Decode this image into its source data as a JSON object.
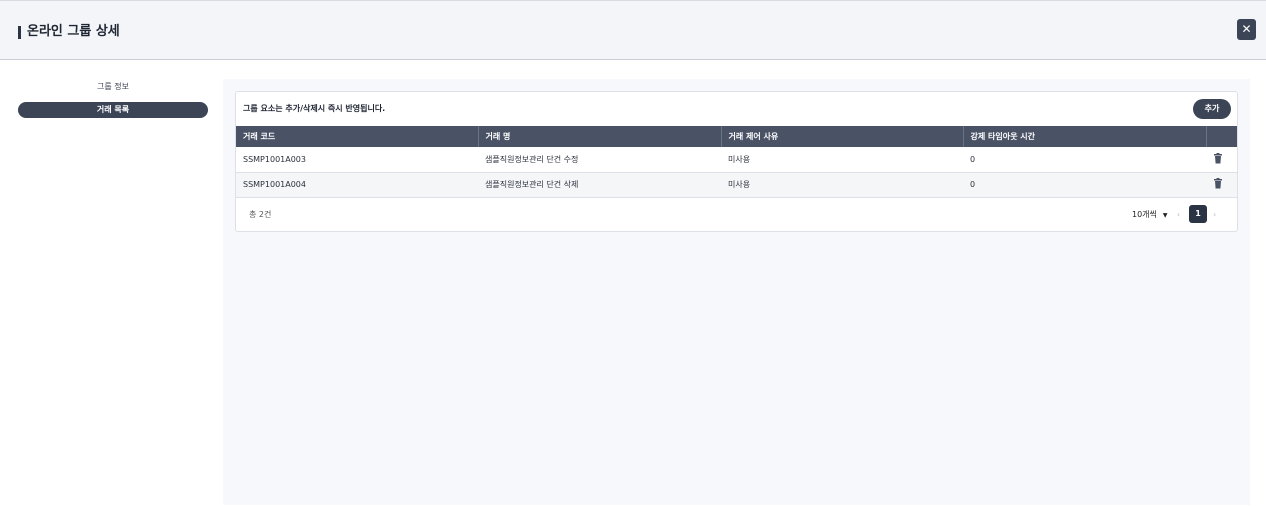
{
  "header": {
    "title": "온라인 그룹 상세",
    "close_glyph": "✕"
  },
  "sidebar": {
    "items": [
      {
        "label": "그룹 정보"
      },
      {
        "label": "거래 목록"
      }
    ]
  },
  "panel": {
    "notice": "그룹 요소는 추가/삭제시 즉시 반영됩니다.",
    "add_label": "추가",
    "columns": [
      "거래 코드",
      "거래 명",
      "거래 제어 사유",
      "강제 타임아웃 시간"
    ],
    "rows": [
      {
        "code": "SSMP1001A003",
        "name": "샘플직원정보관리 단건 수정",
        "reason": "미사용",
        "timeout": "0"
      },
      {
        "code": "SSMP1001A004",
        "name": "샘플직원정보관리 단건 삭제",
        "reason": "미사용",
        "timeout": "0"
      }
    ],
    "total": "총 2건",
    "page_size": "10개씩",
    "current_page": "1",
    "prev_glyph": "‹",
    "next_glyph": "›"
  },
  "icons": {
    "close": "close-icon",
    "delete": "trash-icon",
    "dropdown": "caret-down-icon"
  },
  "colors": {
    "accent": "#3b4556",
    "table_header": "#4a5366",
    "header_bg": "#f3f5f8"
  }
}
